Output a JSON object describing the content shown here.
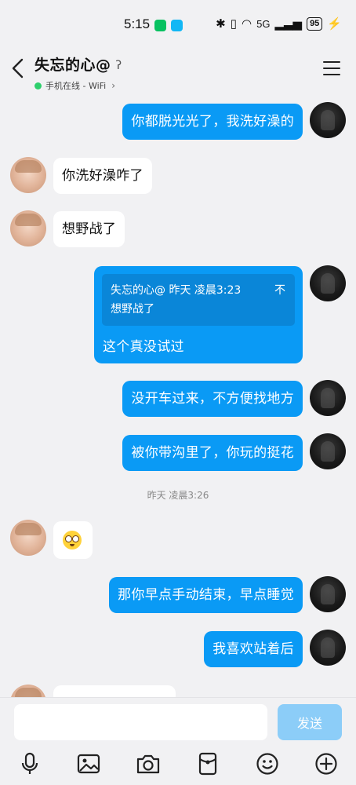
{
  "status_bar": {
    "time": "5:15",
    "battery": "95",
    "network": "5G"
  },
  "header": {
    "title": "失忘的心@",
    "online_status": "手机在线 - WiFi"
  },
  "messages": {
    "m1": "你都脱光光了，我洗好澡的",
    "m2": "你洗好澡咋了",
    "m3": "想野战了",
    "m4_quote_header": "失忘的心@ 昨天 凌晨3:23",
    "m4_quote_tail": "不",
    "m4_quote_body": "想野战了",
    "m4_reply": "这个真没试过",
    "m5": "没开车过来，不方便找地方",
    "m6": "被你带沟里了，你玩的挺花",
    "timestamp": "昨天 凌晨3:26",
    "m7": "那你早点手动结束，早点睡觉",
    "m8": "我喜欢站着后"
  },
  "input": {
    "placeholder": "",
    "send_label": "发送"
  },
  "colors": {
    "self_bubble": "#0a9af5",
    "peer_bubble": "#ffffff",
    "background": "#f1f1f3",
    "online_dot": "#2ecf6c",
    "send_disabled": "#8ccdf8"
  },
  "toolbar_icons": [
    "microphone-icon",
    "image-icon",
    "camera-icon",
    "red-packet-icon",
    "emoji-icon",
    "plus-icon"
  ]
}
